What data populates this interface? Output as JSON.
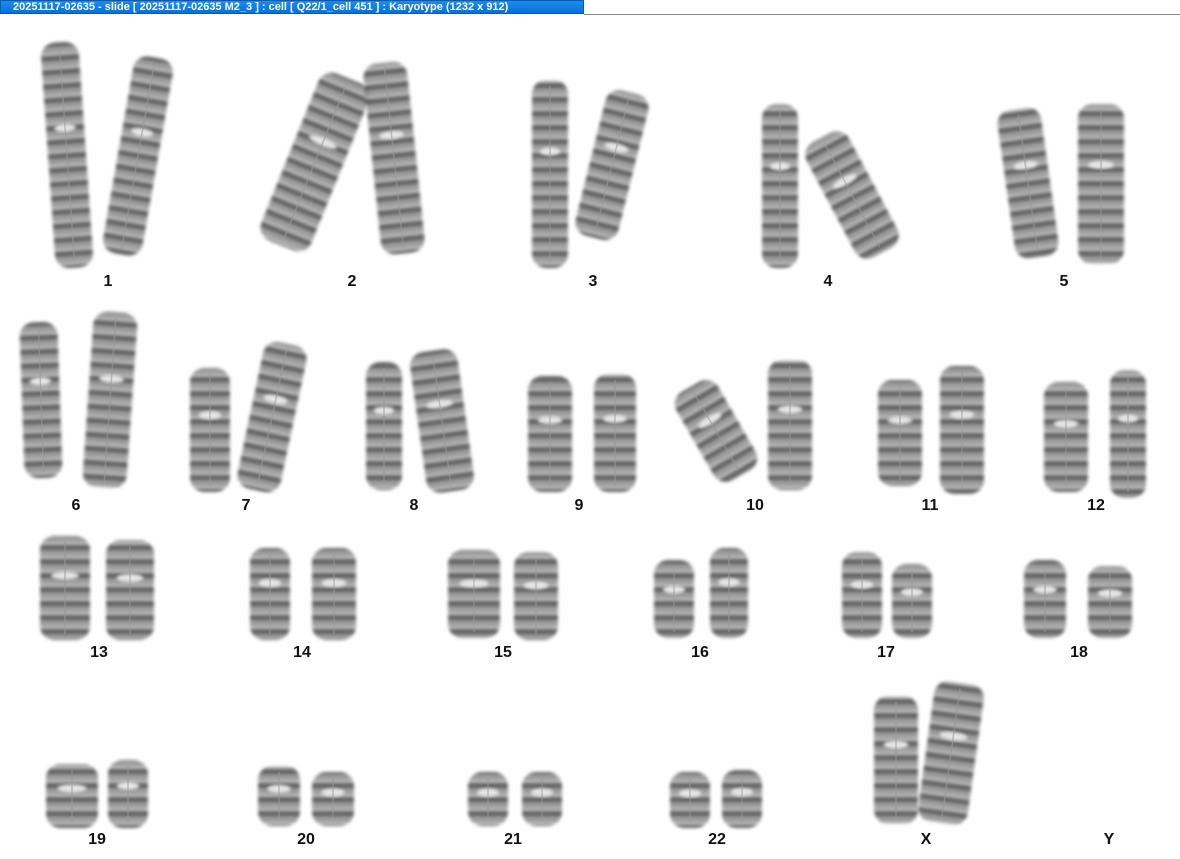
{
  "window": {
    "title": "20251117-02635 - slide [ 20251117-02635 M2_3 ] : cell [ Q22/1_cell 451 ] : Karyotype  (1232 x 912)"
  },
  "karyotype": {
    "labels": [
      "1",
      "2",
      "3",
      "4",
      "5",
      "6",
      "7",
      "8",
      "9",
      "10",
      "11",
      "12",
      "13",
      "14",
      "15",
      "16",
      "17",
      "18",
      "19",
      "20",
      "21",
      "22",
      "X",
      "Y"
    ]
  },
  "colors": {
    "titlebar": "#0a6fd6",
    "chromosome_dark": "#2a2a2a",
    "chromosome_light": "#cfcfcf",
    "background": "#ffffff"
  }
}
